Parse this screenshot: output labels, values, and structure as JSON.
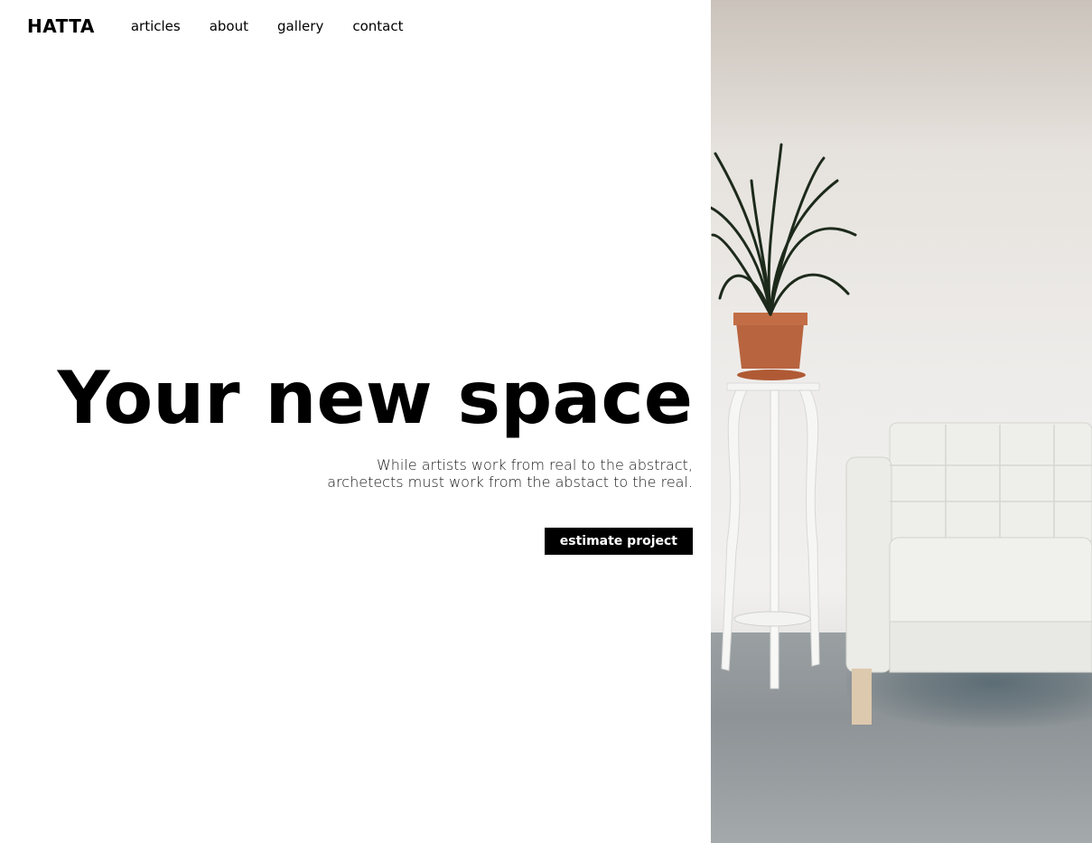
{
  "brand": {
    "logo": "HATTA"
  },
  "nav": {
    "items": [
      {
        "label": "articles"
      },
      {
        "label": "about"
      },
      {
        "label": "gallery"
      },
      {
        "label": "contact"
      }
    ]
  },
  "hero": {
    "headline": "Your new space",
    "subtext_line1": "While artists work from real to the abstract,",
    "subtext_line2": "archetects must work from the abstact to the real.",
    "cta_label": "estimate project"
  },
  "colors": {
    "text": "#000000",
    "background": "#ffffff",
    "button_bg": "#000000",
    "button_text": "#ffffff"
  },
  "photo": {
    "subject": "interior-plant-stand-sofa-photo"
  }
}
